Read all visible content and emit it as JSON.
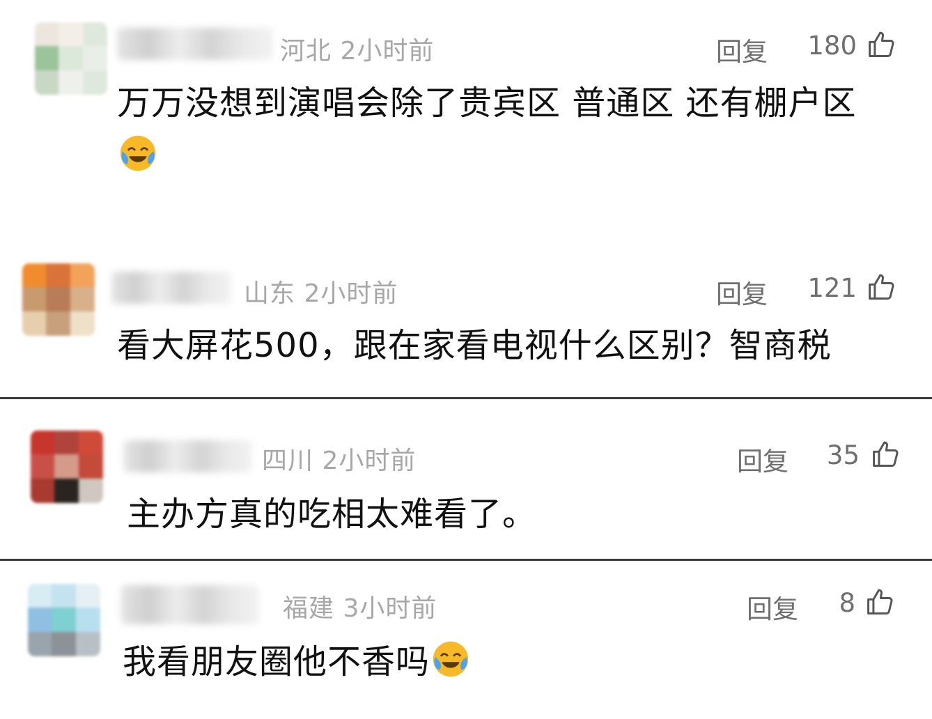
{
  "comments": [
    {
      "location": "河北",
      "time": "2小时前",
      "reply_label": "回复",
      "likes": "180",
      "text": "万万没想到演唱会除了贵宾区 普通区 还有棚户区",
      "emoji": "laughing-crying-emoji"
    },
    {
      "location": "山东",
      "time": "2小时前",
      "reply_label": "回复",
      "likes": "121",
      "text": "看大屏花500，跟在家看电视什么区别？智商税"
    },
    {
      "location": "四川",
      "time": "2小时前",
      "reply_label": "回复",
      "likes": "35",
      "text": "主办方真的吃相太难看了。"
    },
    {
      "location": "福建",
      "time": "3小时前",
      "reply_label": "回复",
      "likes": "8",
      "text": "我看朋友圈他不香吗",
      "emoji": "laughing-crying-emoji"
    }
  ],
  "icons": {
    "like": "thumbs-up-icon"
  },
  "colors": {
    "meta_text": "#a7a7a7",
    "action_text": "#6f6f6f",
    "body_text": "#111111",
    "divider": "#3a3a3a"
  }
}
